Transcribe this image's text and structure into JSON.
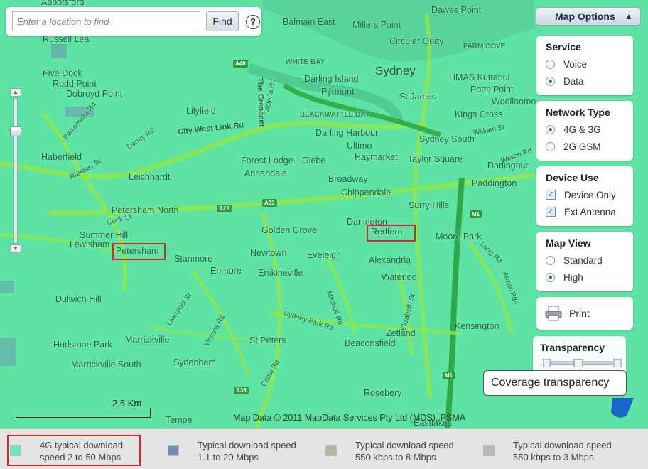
{
  "search": {
    "placeholder": "Enter a location to find",
    "find_label": "Find",
    "help_glyph": "?"
  },
  "map_options": {
    "title": "Map Options",
    "collapse_glyph": "▲",
    "service": {
      "title": "Service",
      "options": [
        {
          "label": "Voice",
          "selected": false
        },
        {
          "label": "Data",
          "selected": true
        }
      ]
    },
    "network_type": {
      "title": "Network Type",
      "options": [
        {
          "label": "4G & 3G",
          "selected": true
        },
        {
          "label": "2G GSM",
          "selected": false
        }
      ]
    },
    "device_use": {
      "title": "Device Use",
      "options": [
        {
          "label": "Device Only",
          "checked": true
        },
        {
          "label": "Ext Antenna",
          "checked": true
        }
      ]
    },
    "map_view": {
      "title": "Map View",
      "options": [
        {
          "label": "Standard",
          "selected": false
        },
        {
          "label": "High",
          "selected": true
        }
      ]
    },
    "print_label": "Print",
    "transparency": {
      "title": "Transparency",
      "tooltip": "Coverage transparency"
    }
  },
  "map": {
    "places": [
      {
        "name": "Abbotsford"
      },
      {
        "name": "Balmain East"
      },
      {
        "name": "Millers Point"
      },
      {
        "name": "Dawes Point"
      },
      {
        "name": "Russell Lea"
      },
      {
        "name": "Circular Quay"
      },
      {
        "name": "Five Dock"
      },
      {
        "name": "Rodd Point"
      },
      {
        "name": "Dobroyd Point"
      },
      {
        "name": "Darling Island"
      },
      {
        "name": "Pyrmont"
      },
      {
        "name": "HMAS Kuttabul"
      },
      {
        "name": "Potts Point"
      },
      {
        "name": "Woolloomo"
      },
      {
        "name": "St James"
      },
      {
        "name": "Lilyfield"
      },
      {
        "name": "Kings Cross"
      },
      {
        "name": "Darling Harbour"
      },
      {
        "name": "Sydney South"
      },
      {
        "name": "Haberfield"
      },
      {
        "name": "Ultimo"
      },
      {
        "name": "Forest Lodge"
      },
      {
        "name": "Glebe"
      },
      {
        "name": "Haymarket"
      },
      {
        "name": "Taylor Square"
      },
      {
        "name": "Darlinghur"
      },
      {
        "name": "Leichhardt"
      },
      {
        "name": "Annandale"
      },
      {
        "name": "Broadway"
      },
      {
        "name": "Paddington"
      },
      {
        "name": "Chippendale"
      },
      {
        "name": "Surry Hills"
      },
      {
        "name": "Petersham North"
      },
      {
        "name": "Darlington"
      },
      {
        "name": "Golden Grove"
      },
      {
        "name": "Moore Park"
      },
      {
        "name": "Summer Hill"
      },
      {
        "name": "Lewisham"
      },
      {
        "name": "Newtown"
      },
      {
        "name": "Eveleigh"
      },
      {
        "name": "Stanmore"
      },
      {
        "name": "Alexandria"
      },
      {
        "name": "Enmore"
      },
      {
        "name": "Erskineville"
      },
      {
        "name": "Waterloo"
      },
      {
        "name": "Dulwich Hill"
      },
      {
        "name": "Kensington"
      },
      {
        "name": "Zetland"
      },
      {
        "name": "Hurlstone Park"
      },
      {
        "name": "Marrickville"
      },
      {
        "name": "St Peters"
      },
      {
        "name": "Beaconsfield"
      },
      {
        "name": "Marrickville South"
      },
      {
        "name": "Sydenham"
      },
      {
        "name": "Rosebery"
      },
      {
        "name": "Tempe"
      },
      {
        "name": "Eastlakes"
      }
    ],
    "highlighted_places": [
      "Petersham",
      "Redfern"
    ],
    "city_label": "Sydney",
    "roads": [
      "City West Link Rd",
      "The Crescent",
      "Victoria Rd",
      "Darley Rd",
      "Ramsay St",
      "Cook St",
      "Sydney Park Rd",
      "Mitchell Rd",
      "Elizabeth St",
      "Victoria Rd",
      "Canal Rd",
      "Liverpool St",
      "Lang Rd",
      "Anzac Pde",
      "Wilson Rd",
      "William St",
      "Parramatta Rd"
    ],
    "small_labels": [
      "WHITE BAY",
      "BLACKWATTLE BAY",
      "FARM COVE"
    ],
    "shields": [
      "A40",
      "A22",
      "A22",
      "M1",
      "M1",
      "A36"
    ],
    "scale_label": "2.5 Km",
    "copyright": "Map Data © 2011 MapData Services Pty Ltd (MDS), PSMA",
    "colors": {
      "coverage_4g": "#5ee3a5",
      "roads": "#8ee64f",
      "highlight": "#d8262c"
    }
  },
  "legend": {
    "items": [
      {
        "line1": "4G typical download",
        "line2": "speed 2 to 50 Mbps",
        "color": "#6ee8b2"
      },
      {
        "line1": "Typical download speed",
        "line2": "1.1 to 20 Mbps",
        "color": "#6d8fb4"
      },
      {
        "line1": "Typical download speed",
        "line2": "550 kbps to 8 Mbps",
        "color": "#a9bca2"
      },
      {
        "line1": "Typical download speed",
        "line2": "550 kbps to 3 Mbps",
        "color": "#b8b8b8"
      }
    ]
  }
}
